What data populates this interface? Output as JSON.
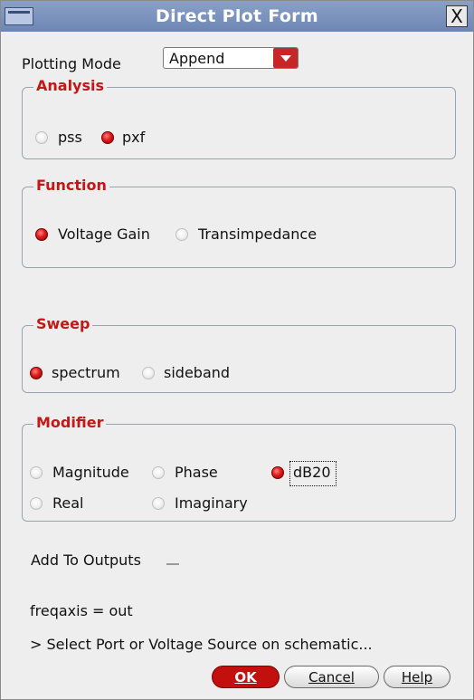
{
  "window": {
    "title": "Direct Plot Form",
    "close_label": "X"
  },
  "plotting_mode": {
    "label": "Plotting Mode",
    "value": "Append"
  },
  "analysis": {
    "title": "Analysis",
    "options": [
      {
        "label": "pss",
        "selected": false
      },
      {
        "label": "pxf",
        "selected": true
      }
    ]
  },
  "function": {
    "title": "Function",
    "options": [
      {
        "label": "Voltage Gain",
        "selected": true
      },
      {
        "label": "Transimpedance",
        "selected": false
      }
    ]
  },
  "sweep": {
    "title": "Sweep",
    "options": [
      {
        "label": "spectrum",
        "selected": true
      },
      {
        "label": "sideband",
        "selected": false
      }
    ]
  },
  "modifier": {
    "title": "Modifier",
    "options": [
      {
        "label": "Magnitude",
        "selected": false
      },
      {
        "label": "Phase",
        "selected": false
      },
      {
        "label": "dB20",
        "selected": true
      },
      {
        "label": "Real",
        "selected": false
      },
      {
        "label": "Imaginary",
        "selected": false
      }
    ]
  },
  "add_to_outputs": {
    "label": "Add To Outputs",
    "checked": false
  },
  "status": {
    "line1": "freqaxis = out",
    "line2": "> Select Port or Voltage Source on schematic..."
  },
  "buttons": {
    "ok": "OK",
    "cancel": "Cancel",
    "help": "Help"
  },
  "colors": {
    "accent_red": "#c41717",
    "title_bar": "#7a91bf"
  }
}
